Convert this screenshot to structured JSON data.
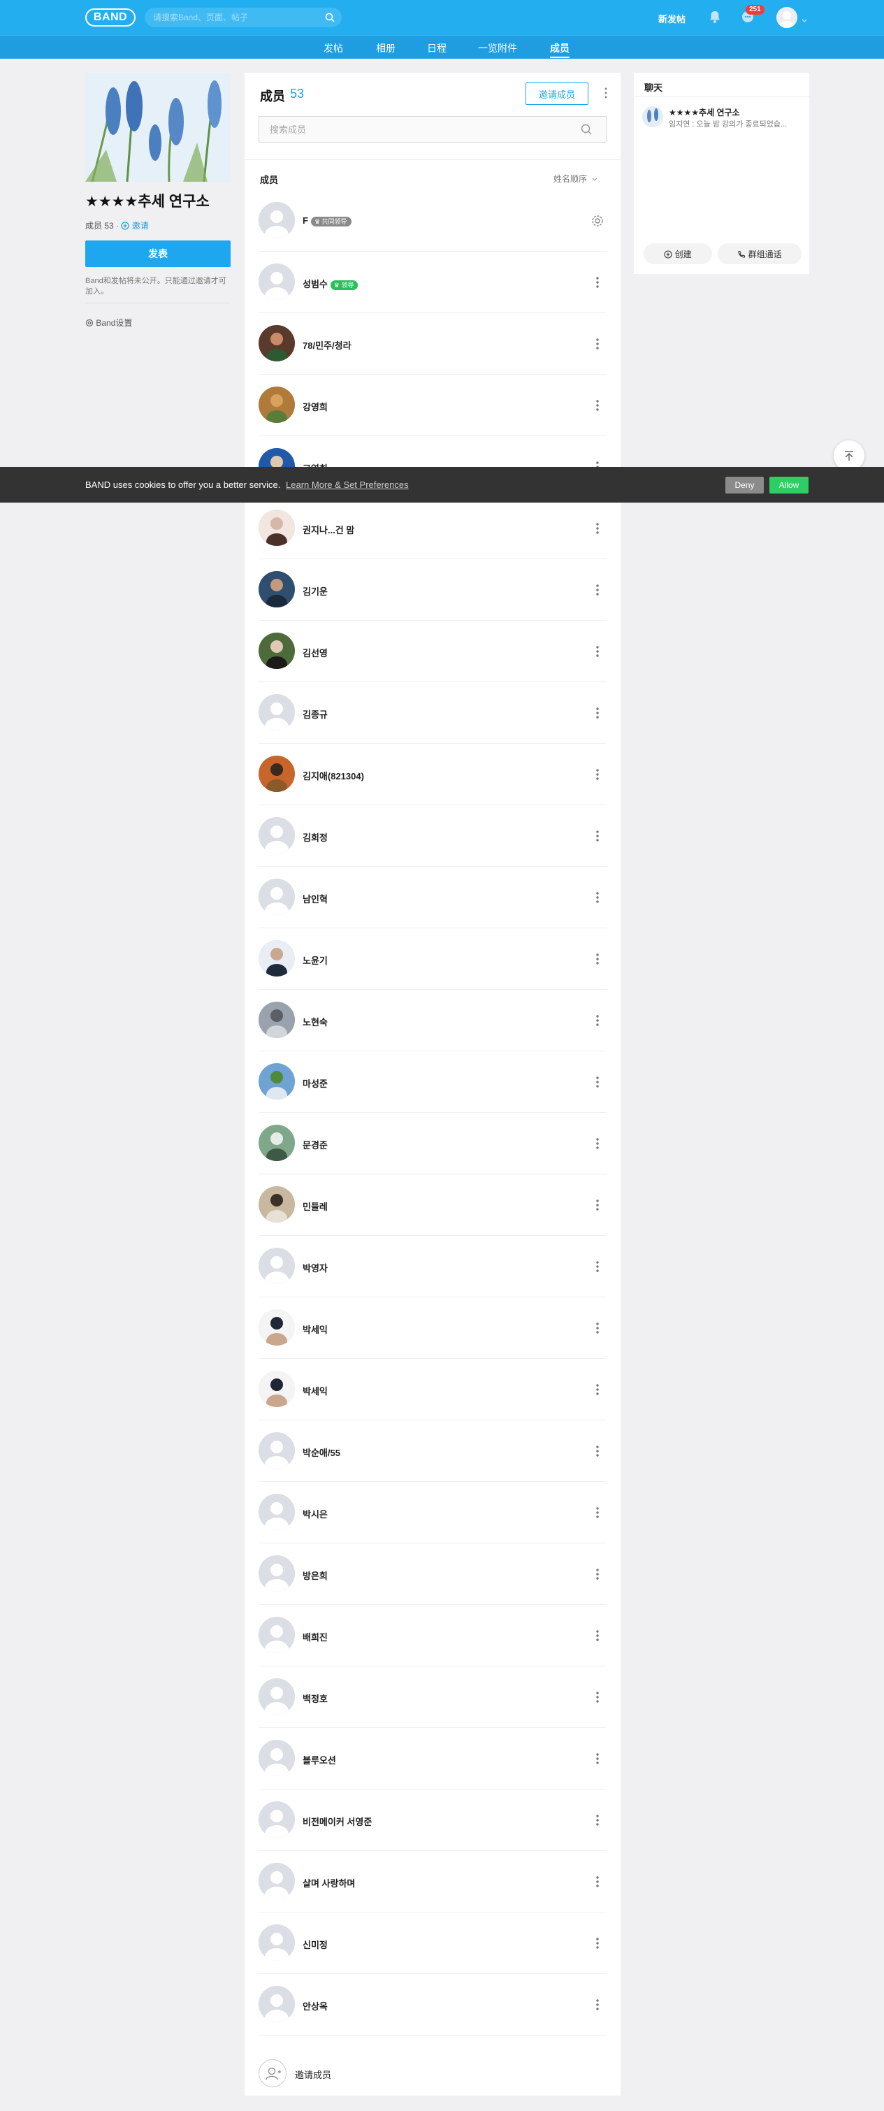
{
  "header": {
    "logo": "BAND",
    "search_placeholder": "请搜索Band、页面、帖子",
    "new_post": "新发帖",
    "notification_badge": "251"
  },
  "subnav": [
    {
      "label": "发帖"
    },
    {
      "label": "相册"
    },
    {
      "label": "日程"
    },
    {
      "label": "一览附件"
    },
    {
      "label": "成员",
      "active": true
    }
  ],
  "band": {
    "name": "★★★★추세 연구소",
    "member_label": "成员 53",
    "separator": "·",
    "invite": "邀请",
    "post_button": "发表",
    "description": "Band和发帖将未公开。只能通过邀请才可加入。",
    "settings": "Band设置"
  },
  "members": {
    "title": "成员",
    "count": "53",
    "invite_button": "邀请成员",
    "search_placeholder": "搜索成员",
    "list_label": "成员",
    "sort_label": "姓名顺序",
    "items": [
      {
        "name": "F",
        "tag": "共同领导"
      },
      {
        "name": "성범수",
        "tag": "领导"
      },
      {
        "name": "78/민주/청라"
      },
      {
        "name": "강영희"
      },
      {
        "name": "고영희"
      },
      {
        "name": "권지나...건 맘"
      },
      {
        "name": "김기운"
      },
      {
        "name": "김선영"
      },
      {
        "name": "김종규"
      },
      {
        "name": "김지애(821304)"
      },
      {
        "name": "김희정"
      },
      {
        "name": "남인혁"
      },
      {
        "name": "노윤기"
      },
      {
        "name": "노현숙"
      },
      {
        "name": "마성준"
      },
      {
        "name": "문경준"
      },
      {
        "name": "민들레"
      },
      {
        "name": "박영자"
      },
      {
        "name": "박세익"
      },
      {
        "name": "박세익"
      },
      {
        "name": "박순애/55"
      },
      {
        "name": "박시은"
      },
      {
        "name": "방은희"
      },
      {
        "name": "배희진"
      },
      {
        "name": "백정호"
      },
      {
        "name": "블루오션"
      },
      {
        "name": "비전메이커 서영준"
      },
      {
        "name": "살며 사랑하며"
      },
      {
        "name": "신미정"
      },
      {
        "name": "안상옥"
      }
    ],
    "invite_row_label": "邀请成员"
  },
  "chat": {
    "title": "聊天",
    "room_name": "★★★★추세 연구소",
    "last_message": "임지연 : 오늘 밤 강의가 종료되었습...",
    "create_button": "创建",
    "group_call_button": "群组通话"
  },
  "cookie": {
    "text": "BAND uses cookies to offer you a better service.",
    "link": "Learn More & Set Preferences",
    "deny": "Deny",
    "allow": "Allow"
  },
  "colors": {
    "brand": "#23aef0",
    "leader_tag": "#27c05a",
    "badge": "#f43a3a",
    "allow": "#2ccf64"
  }
}
